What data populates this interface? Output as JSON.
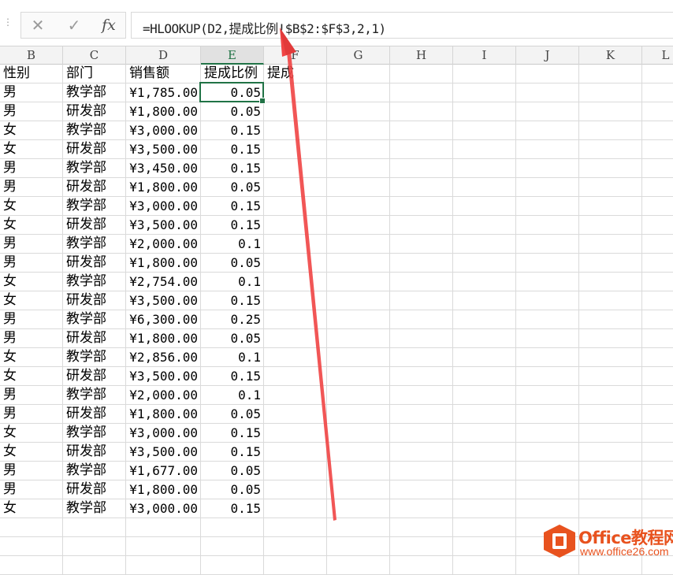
{
  "formula_bar": {
    "cancel_icon": "✕",
    "enter_icon": "✓",
    "fx_label": "fx",
    "formula": "=HLOOKUP(D2,提成比例!$B$2:$F$3,2,1)"
  },
  "columns": [
    "B",
    "C",
    "D",
    "E",
    "F",
    "G",
    "H",
    "I",
    "J",
    "K",
    "L"
  ],
  "selected_column": "E",
  "header_row": {
    "b": "性别",
    "c": "部门",
    "d": "销售额",
    "e": "提成比例",
    "f": "提成"
  },
  "rows": [
    {
      "b": "男",
      "c": "教学部",
      "d": "¥1,785.00",
      "e": "0.05"
    },
    {
      "b": "男",
      "c": "研发部",
      "d": "¥1,800.00",
      "e": "0.05"
    },
    {
      "b": "女",
      "c": "教学部",
      "d": "¥3,000.00",
      "e": "0.15"
    },
    {
      "b": "女",
      "c": "研发部",
      "d": "¥3,500.00",
      "e": "0.15"
    },
    {
      "b": "男",
      "c": "教学部",
      "d": "¥3,450.00",
      "e": "0.15"
    },
    {
      "b": "男",
      "c": "研发部",
      "d": "¥1,800.00",
      "e": "0.05"
    },
    {
      "b": "女",
      "c": "教学部",
      "d": "¥3,000.00",
      "e": "0.15"
    },
    {
      "b": "女",
      "c": "研发部",
      "d": "¥3,500.00",
      "e": "0.15"
    },
    {
      "b": "男",
      "c": "教学部",
      "d": "¥2,000.00",
      "e": "0.1"
    },
    {
      "b": "男",
      "c": "研发部",
      "d": "¥1,800.00",
      "e": "0.05"
    },
    {
      "b": "女",
      "c": "教学部",
      "d": "¥2,754.00",
      "e": "0.1"
    },
    {
      "b": "女",
      "c": "研发部",
      "d": "¥3,500.00",
      "e": "0.15"
    },
    {
      "b": "男",
      "c": "教学部",
      "d": "¥6,300.00",
      "e": "0.25"
    },
    {
      "b": "男",
      "c": "研发部",
      "d": "¥1,800.00",
      "e": "0.05"
    },
    {
      "b": "女",
      "c": "教学部",
      "d": "¥2,856.00",
      "e": "0.1"
    },
    {
      "b": "女",
      "c": "研发部",
      "d": "¥3,500.00",
      "e": "0.15"
    },
    {
      "b": "男",
      "c": "教学部",
      "d": "¥2,000.00",
      "e": "0.1"
    },
    {
      "b": "男",
      "c": "研发部",
      "d": "¥1,800.00",
      "e": "0.05"
    },
    {
      "b": "女",
      "c": "教学部",
      "d": "¥3,000.00",
      "e": "0.15"
    },
    {
      "b": "女",
      "c": "研发部",
      "d": "¥3,500.00",
      "e": "0.15"
    },
    {
      "b": "男",
      "c": "教学部",
      "d": "¥1,677.00",
      "e": "0.05"
    },
    {
      "b": "男",
      "c": "研发部",
      "d": "¥1,800.00",
      "e": "0.05"
    },
    {
      "b": "女",
      "c": "教学部",
      "d": "¥3,000.00",
      "e": "0.15"
    }
  ],
  "watermark": {
    "main": "Office教程网",
    "sub": "www.office26.com"
  },
  "colors": {
    "accent": "#217346",
    "arrow": "#f04444",
    "logo": "#e8521e"
  }
}
